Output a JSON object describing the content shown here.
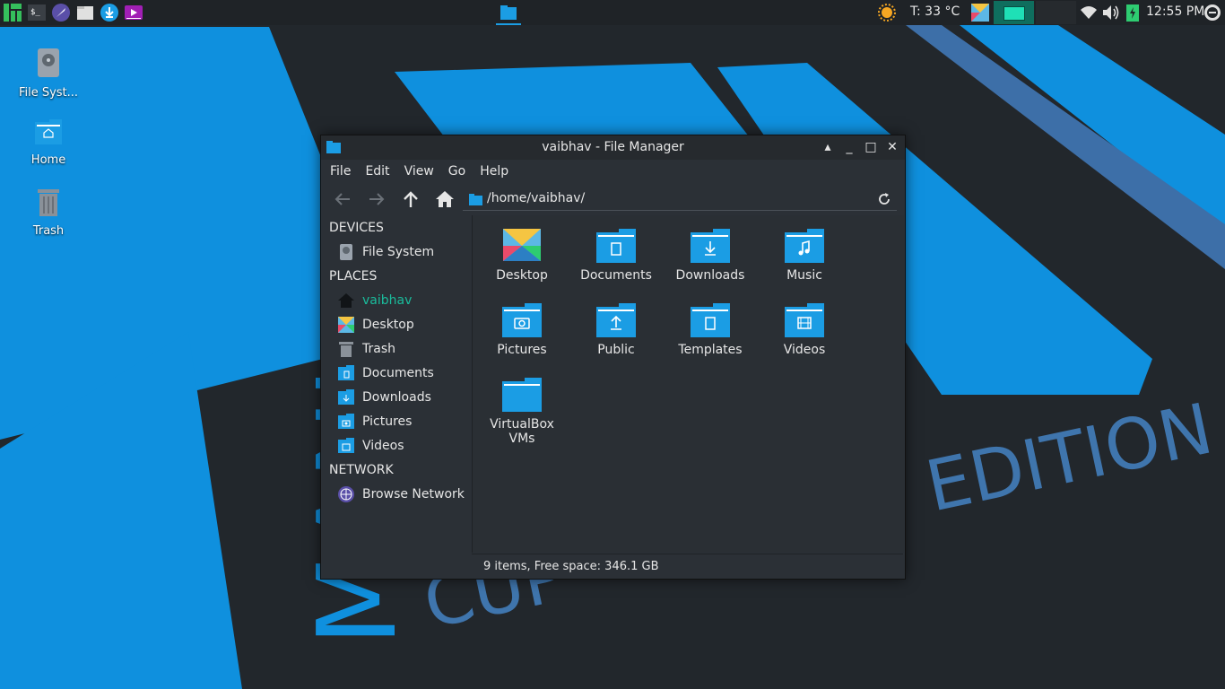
{
  "wallpaper": {
    "text_top": "MANJARO",
    "text_edition": "EDITION",
    "text_cup": "CUP"
  },
  "panel": {
    "temperature": "T: 33 °C",
    "clock": "12:55 PM",
    "launchers": [
      "manjaro-menu-icon",
      "terminal-icon",
      "browser-icon",
      "files-icon",
      "download-icon",
      "media-icon"
    ]
  },
  "desktop": {
    "icons": [
      {
        "label": "File Syst...",
        "icon": "drive-icon"
      },
      {
        "label": "Home",
        "icon": "home-folder-icon"
      },
      {
        "label": "Trash",
        "icon": "trash-icon"
      }
    ]
  },
  "window": {
    "title": "vaibhav - File Manager",
    "menu": [
      "File",
      "Edit",
      "View",
      "Go",
      "Help"
    ],
    "address": "/home/vaibhav/",
    "sidebar": {
      "devices_heading": "DEVICES",
      "places_heading": "PLACES",
      "network_heading": "NETWORK",
      "devices": [
        {
          "label": "File System",
          "icon": "drive-icon"
        }
      ],
      "places": [
        {
          "label": "vaibhav",
          "icon": "home-icon",
          "active": true
        },
        {
          "label": "Desktop",
          "icon": "desktop-icon"
        },
        {
          "label": "Trash",
          "icon": "trash-icon"
        },
        {
          "label": "Documents",
          "icon": "documents-folder-icon"
        },
        {
          "label": "Downloads",
          "icon": "downloads-folder-icon"
        },
        {
          "label": "Pictures",
          "icon": "pictures-folder-icon"
        },
        {
          "label": "Videos",
          "icon": "videos-folder-icon"
        }
      ],
      "network": [
        {
          "label": "Browse Network",
          "icon": "network-icon"
        }
      ]
    },
    "files": [
      {
        "name": "Desktop",
        "icon": "desktop-folder-icon"
      },
      {
        "name": "Documents",
        "icon": "documents-folder-icon"
      },
      {
        "name": "Downloads",
        "icon": "downloads-folder-icon"
      },
      {
        "name": "Music",
        "icon": "music-folder-icon"
      },
      {
        "name": "Pictures",
        "icon": "pictures-folder-icon"
      },
      {
        "name": "Public",
        "icon": "public-folder-icon"
      },
      {
        "name": "Templates",
        "icon": "templates-folder-icon"
      },
      {
        "name": "Videos",
        "icon": "videos-folder-icon"
      },
      {
        "name": "VirtualBox VMs",
        "icon": "folder-icon"
      }
    ],
    "status": "9 items, Free space: 346.1 GB"
  },
  "colors": {
    "accent": "#0f9ae3",
    "active": "#1abc9c",
    "panel": "#1f2327"
  }
}
